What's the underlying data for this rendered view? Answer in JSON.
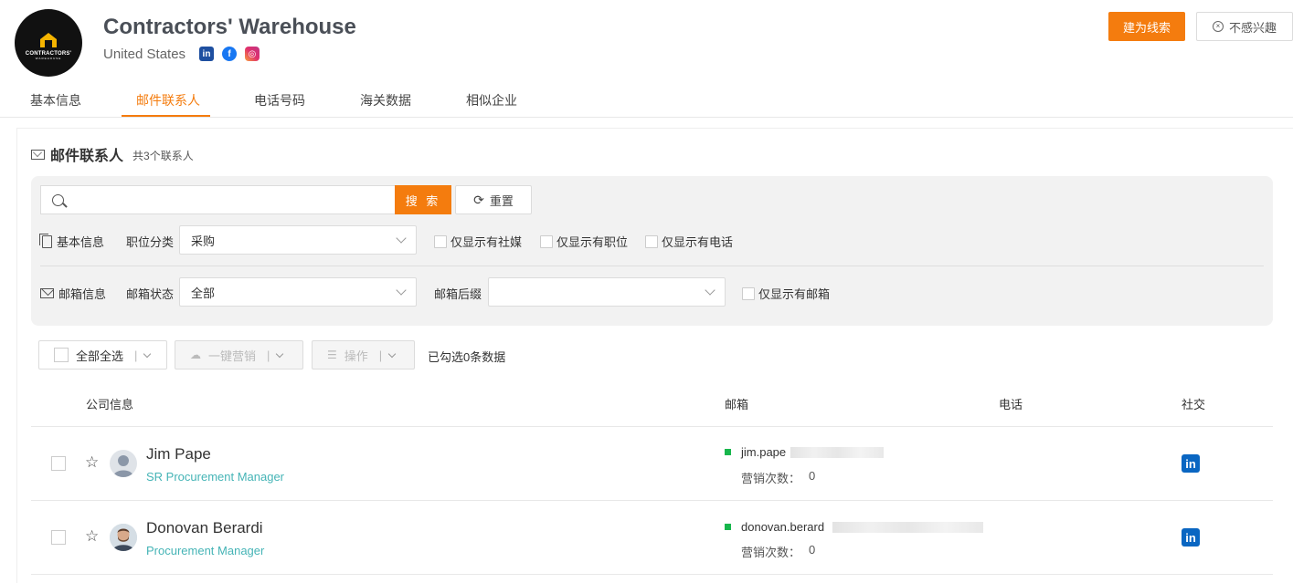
{
  "company": {
    "logo_text": "CONTRACTORS'",
    "logo_sub": "WAREHOUSE",
    "name": "Contractors' Warehouse",
    "country": "United States",
    "social": {
      "linkedin": "in",
      "facebook": "f",
      "instagram": "◎"
    }
  },
  "actions": {
    "lead_label": "建为线索",
    "nointerest_label": "不感兴趣"
  },
  "tabs": [
    {
      "label": "基本信息"
    },
    {
      "label": "邮件联系人"
    },
    {
      "label": "电话号码"
    },
    {
      "label": "海关数据"
    },
    {
      "label": "相似企业"
    }
  ],
  "section": {
    "title": "邮件联系人",
    "count": "共3个联系人"
  },
  "filters": {
    "search_value": "",
    "search_label": "搜 索",
    "reset_label": "重置",
    "basic_label": "基本信息",
    "position_label": "职位分类",
    "position_value": "采购",
    "chk_social": "仅显示有社媒",
    "chk_position": "仅显示有职位",
    "chk_phone": "仅显示有电话",
    "email_label": "邮箱信息",
    "email_status_label": "邮箱状态",
    "email_status_value": "全部",
    "email_suffix_label": "邮箱后缀",
    "email_suffix_value": "",
    "chk_email": "仅显示有邮箱"
  },
  "toolbar": {
    "select_all": "全部全选",
    "marketing": "一键营销",
    "operation": "操作",
    "selected_count": "已勾选0条数据"
  },
  "table": {
    "headers": {
      "company": "公司信息",
      "email": "邮箱",
      "phone": "电话",
      "social": "社交"
    },
    "rows": [
      {
        "name": "Jim Pape",
        "title": "SR Procurement Manager",
        "email": "jim.pape",
        "mk_label": "营销次数：",
        "mk_count": "0",
        "social": "in"
      },
      {
        "name": "Donovan Berardi",
        "title": "Procurement Manager",
        "email": "donovan.berard",
        "mk_label": "营销次数：",
        "mk_count": "0",
        "social": "in"
      }
    ]
  },
  "colors": {
    "accent": "#f47c0e",
    "title_teal": "#45b4b6",
    "email_ok": "#17b64c",
    "linkedin": "#0a66c2"
  }
}
